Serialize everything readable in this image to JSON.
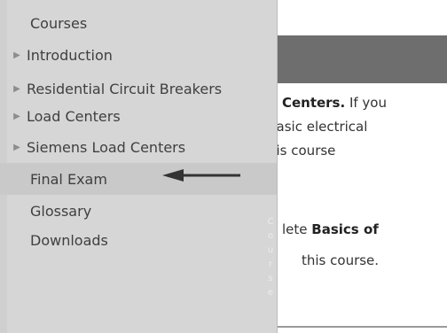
{
  "menu": {
    "items": [
      {
        "label": "Courses",
        "has_arrow": false
      },
      {
        "label": "Introduction",
        "has_arrow": true
      },
      {
        "label": "Residential Circuit Breakers",
        "has_arrow": true
      },
      {
        "label": "Load Centers",
        "has_arrow": true
      },
      {
        "label": "Siemens Load Centers",
        "has_arrow": true
      },
      {
        "label": "Final Exam",
        "has_arrow": false,
        "selected": true
      },
      {
        "label": "Glossary",
        "has_arrow": false
      },
      {
        "label": "Downloads",
        "has_arrow": false
      }
    ],
    "vertical_tab_label": [
      "C",
      "o",
      "u",
      "r",
      "s",
      "e"
    ],
    "arrow_glyph": "▶"
  },
  "page": {
    "line1_bold": "d Centers.",
    "line1_rest": " If you",
    "line2": "basic electrical",
    "line3": "his course",
    "line4_prefix": "lete ",
    "line4_bold": "Basics of",
    "line5": "this course."
  },
  "colors": {
    "menu_bg": "#d6d6d6",
    "selected_bg": "#c9c9c9",
    "header_bar": "#6e6e6e",
    "pointer_arrow": "#333333"
  }
}
